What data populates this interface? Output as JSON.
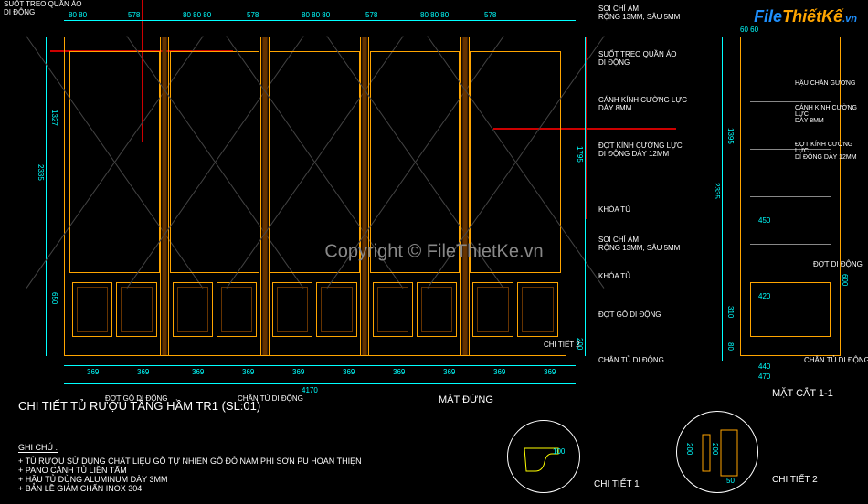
{
  "logo": {
    "part1": "File",
    "part2": "ThiếtKế",
    "part3": ".vn"
  },
  "copyright": "Copyright © FileThietKe.vn",
  "main_title": "CHI TIẾT TỦ RƯỢU TẦNG HẦM TR1 (SL:01)",
  "views": {
    "elevation": "MẶT ĐỨNG",
    "section": "MẶT CẮT 1-1",
    "detail1": "CHI TIẾT 1",
    "detail2": "CHI TIẾT 2"
  },
  "notes": {
    "title": "GHI CHÚ :",
    "items": [
      "TỦ RƯỢU SỬ DỤNG CHẤT LIỆU GỖ TỰ NHIÊN GỖ ĐỎ NAM PHI SƠN PU HOÀN THIỆN",
      "PANO CÁNH TỦ LIỀN TẤM",
      "HẬU TỦ DÙNG ALUMINUM DÀY 3MM",
      "BẢN LỀ GIẢM CHẤN INOX 304"
    ]
  },
  "labels": {
    "suot_treo": "SUỐT TREO QUẦN ÁO",
    "di_dong": "DI ĐỘNG",
    "soi_chi_am": "SOI CHỈ ÂM",
    "rong_sau": "RỘNG 13MM, SÂU 5MM",
    "canh_kinh": "CÁNH KÍNH CƯỜNG LỰC",
    "day_8mm": "DÀY 8MM",
    "dot_kinh": "ĐỢT KÍNH CƯỜNG LỰC",
    "di_dong_12mm": "DI ĐỘNG DÀY 12MM",
    "khoa_tu": "KHÓA TỦ",
    "dot_go": "ĐỢT GỖ DI ĐỘNG",
    "chan_tu": "CHÂN TỦ DI ĐỘNG",
    "hau_chan_guong": "HẬU CHẮN GƯƠNG",
    "dot_di_dong": "ĐỢT DI ĐỘNG",
    "chi_tiet_2": "CHI TIẾT 2"
  },
  "dimensions": {
    "elev_top_overall": "80 80",
    "elev_top_578a": "578",
    "elev_top_578b": "578",
    "elev_top_center": "80 80 80",
    "elev_bottom_369": "369",
    "elev_bottom_overall": "4170",
    "elev_left_2335": "2335",
    "elev_left_1327": "1327",
    "elev_left_650": "650",
    "elev_right_1795": "1795",
    "elev_right_200": "200",
    "section_top_60_60": "60 60",
    "section_1395": "1395",
    "section_2335": "2335",
    "section_450": "450",
    "section_420": "420",
    "section_600": "600",
    "section_310": "310",
    "section_80": "80",
    "section_440": "440",
    "section_470": "470",
    "detail1_100": "100",
    "detail2_200": "200",
    "detail2_50": "50"
  }
}
